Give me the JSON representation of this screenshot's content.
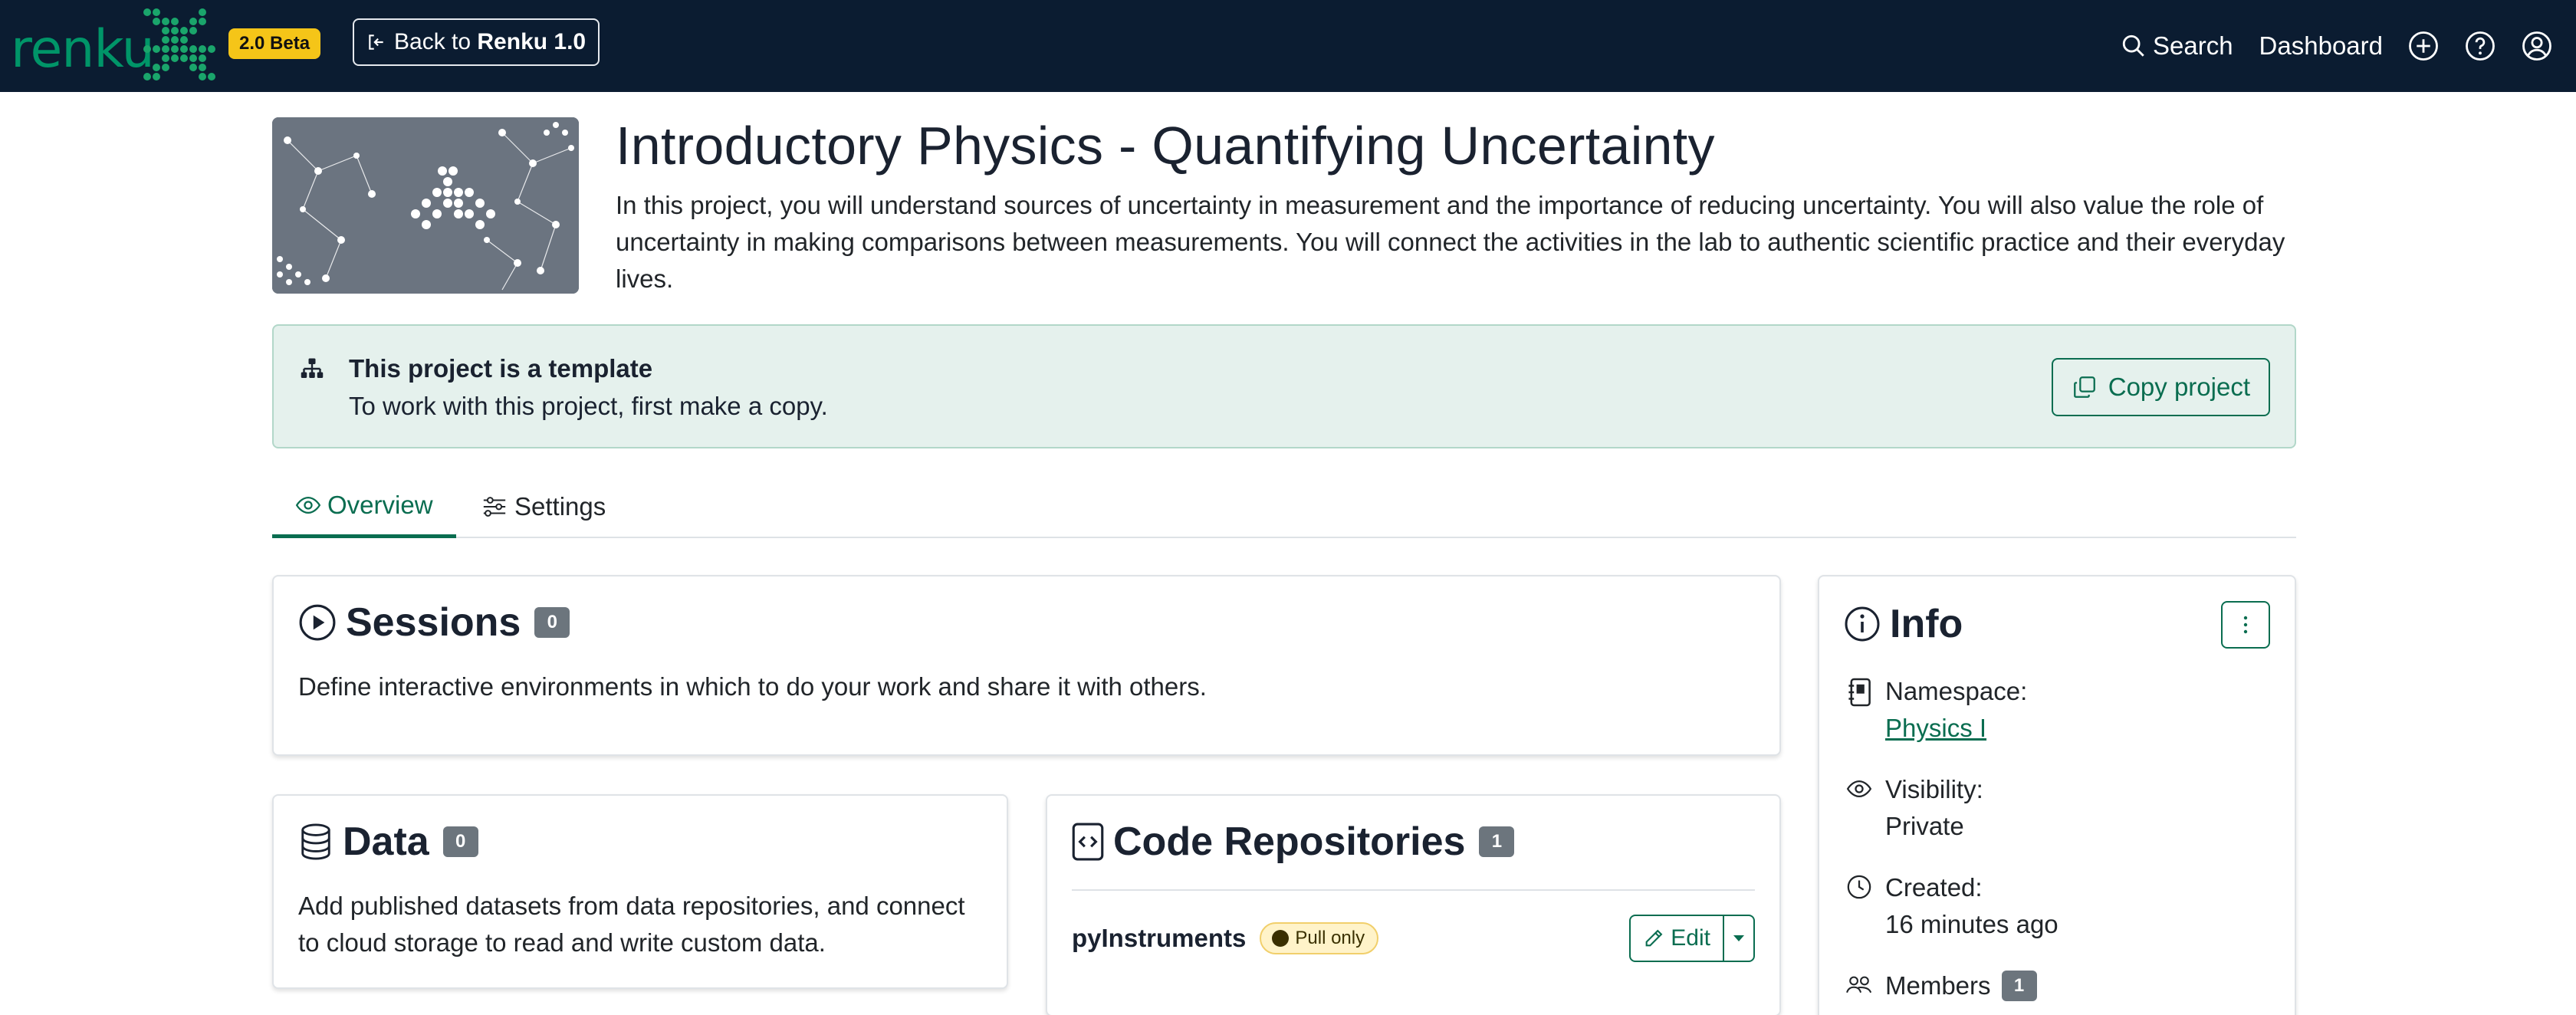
{
  "navbar": {
    "logo_text": "renku",
    "beta_badge": "2.0 Beta",
    "back_prefix": "Back to ",
    "back_strong": "Renku 1.0",
    "search_label": "Search",
    "dashboard_label": "Dashboard",
    "icons": [
      "search-icon",
      "plus-circle-icon",
      "question-circle-icon",
      "user-circle-icon"
    ]
  },
  "project": {
    "title": "Introductory Physics - Quantifying Uncertainty",
    "description": "In this project, you will understand sources of uncertainty in measurement and the importance of reducing uncertainty. You will also value the role of uncertainty in making comparisons between measurements. You will connect the activities in the lab to authentic scientific practice and their everyday lives."
  },
  "template_alert": {
    "title": "This project is a template",
    "text": "To work with this project, first make a copy.",
    "copy_label": "Copy project"
  },
  "tabs": [
    {
      "label": "Overview",
      "active": true
    },
    {
      "label": "Settings",
      "active": false
    }
  ],
  "sessions": {
    "title": "Sessions",
    "count": "0",
    "text": "Define interactive environments in which to do your work and share it with others."
  },
  "data": {
    "title": "Data",
    "count": "0",
    "text": "Add published datasets from data repositories, and connect to cloud storage to read and write custom data."
  },
  "repositories": {
    "title": "Code Repositories",
    "count": "1",
    "items": [
      {
        "name": "pyInstruments",
        "badge": "Pull only",
        "edit_label": "Edit"
      }
    ]
  },
  "info": {
    "title": "Info",
    "namespace_label": "Namespace:",
    "namespace_value": "Physics I",
    "visibility_label": "Visibility:",
    "visibility_value": "Private",
    "created_label": "Created:",
    "created_value": "16 minutes ago",
    "members_label": "Members",
    "members_count": "1"
  },
  "colors": {
    "navbar_bg": "#0b1c31",
    "brand_green": "#009568",
    "accent_green": "#0a6d50",
    "beta_yellow": "#f5c518",
    "alert_bg": "#e5f1ed"
  }
}
